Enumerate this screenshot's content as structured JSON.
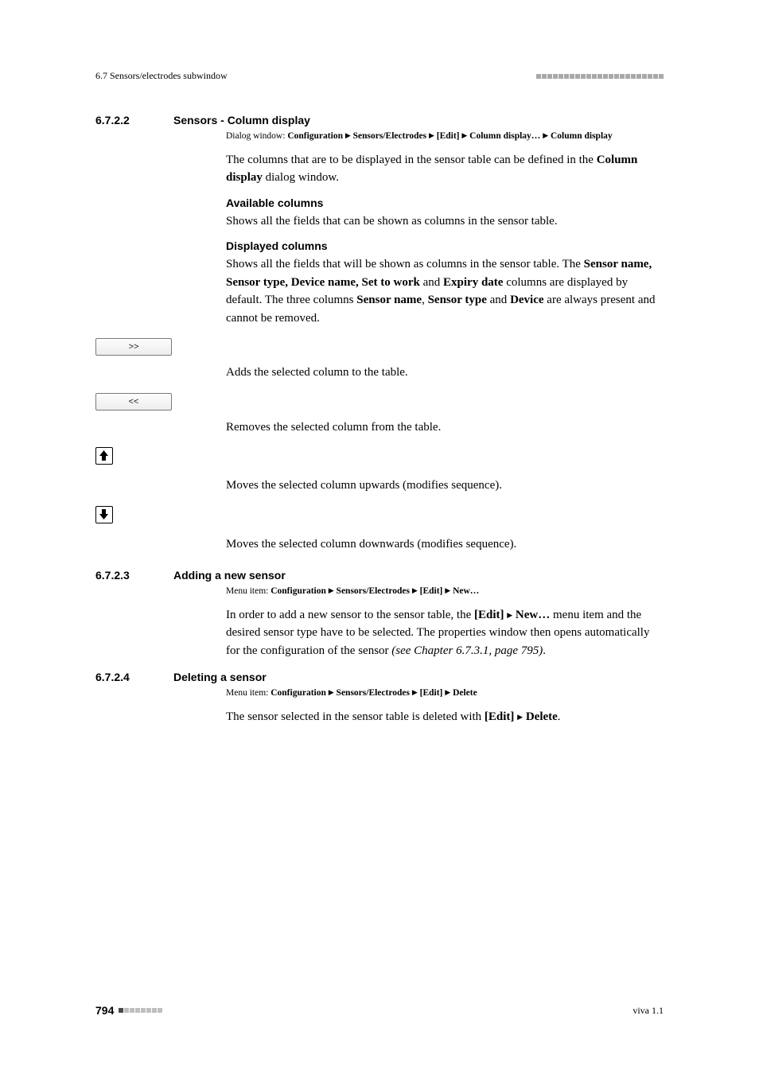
{
  "header": {
    "left": "6.7 Sensors/electrodes subwindow"
  },
  "section_6_7_2_2": {
    "num": "6.7.2.2",
    "title": "Sensors - Column display",
    "path_prefix": "Dialog window: ",
    "path_b1": "Configuration",
    "path_b2": "Sensors/Electrodes",
    "path_b3": "[Edit]",
    "path_b4": "Column display…",
    "path_b5": "Column display",
    "p1_a": "The columns that are to be displayed in the sensor table can be defined in the ",
    "p1_b": "Column display",
    "p1_c": " dialog window.",
    "avail_head": "Available columns",
    "avail_text": "Shows all the fields that can be shown as columns in the sensor table.",
    "disp_head": "Displayed columns",
    "disp_a": "Shows all the fields that will be shown as columns in the sensor table. The ",
    "disp_b": "Sensor name, Sensor type, Device name, Set to work",
    "disp_c": " and ",
    "disp_d": "Expiry date",
    "disp_e": " columns are displayed by default. The three columns ",
    "disp_f": "Sensor name",
    "disp_g": ", ",
    "disp_h": "Sensor type",
    "disp_i": " and ",
    "disp_j": "Device",
    "disp_k": " are always present and cannot be removed.",
    "btn_add_label": ">>",
    "btn_add_desc": "Adds the selected column to the table.",
    "btn_rem_label": "<<",
    "btn_rem_desc": "Removes the selected column from the table.",
    "btn_up_desc": "Moves the selected column upwards (modifies sequence).",
    "btn_down_desc": "Moves the selected column downwards (modifies sequence)."
  },
  "section_6_7_2_3": {
    "num": "6.7.2.3",
    "title": "Adding a new sensor",
    "path_prefix": "Menu item: ",
    "path_b1": "Configuration",
    "path_b2": "Sensors/Electrodes",
    "path_b3": "[Edit]",
    "path_b4": "New…",
    "p_a": "In order to add a new sensor to the sensor table, the ",
    "p_b": "[Edit]",
    "p_c": "New…",
    "p_d": " menu item and the desired sensor type have to be selected. The properties window then opens automatically for the configuration of the sensor ",
    "p_e": "(see Chapter 6.7.3.1, page 795)",
    "p_f": "."
  },
  "section_6_7_2_4": {
    "num": "6.7.2.4",
    "title": "Deleting a sensor",
    "path_prefix": "Menu item: ",
    "path_b1": "Configuration",
    "path_b2": "Sensors/Electrodes",
    "path_b3": "[Edit]",
    "path_b4": "Delete",
    "p_a": "The sensor selected in the sensor table is deleted with ",
    "p_b": "[Edit]",
    "p_c": "Delete",
    "p_d": "."
  },
  "footer": {
    "page": "794",
    "right": "viva 1.1"
  }
}
